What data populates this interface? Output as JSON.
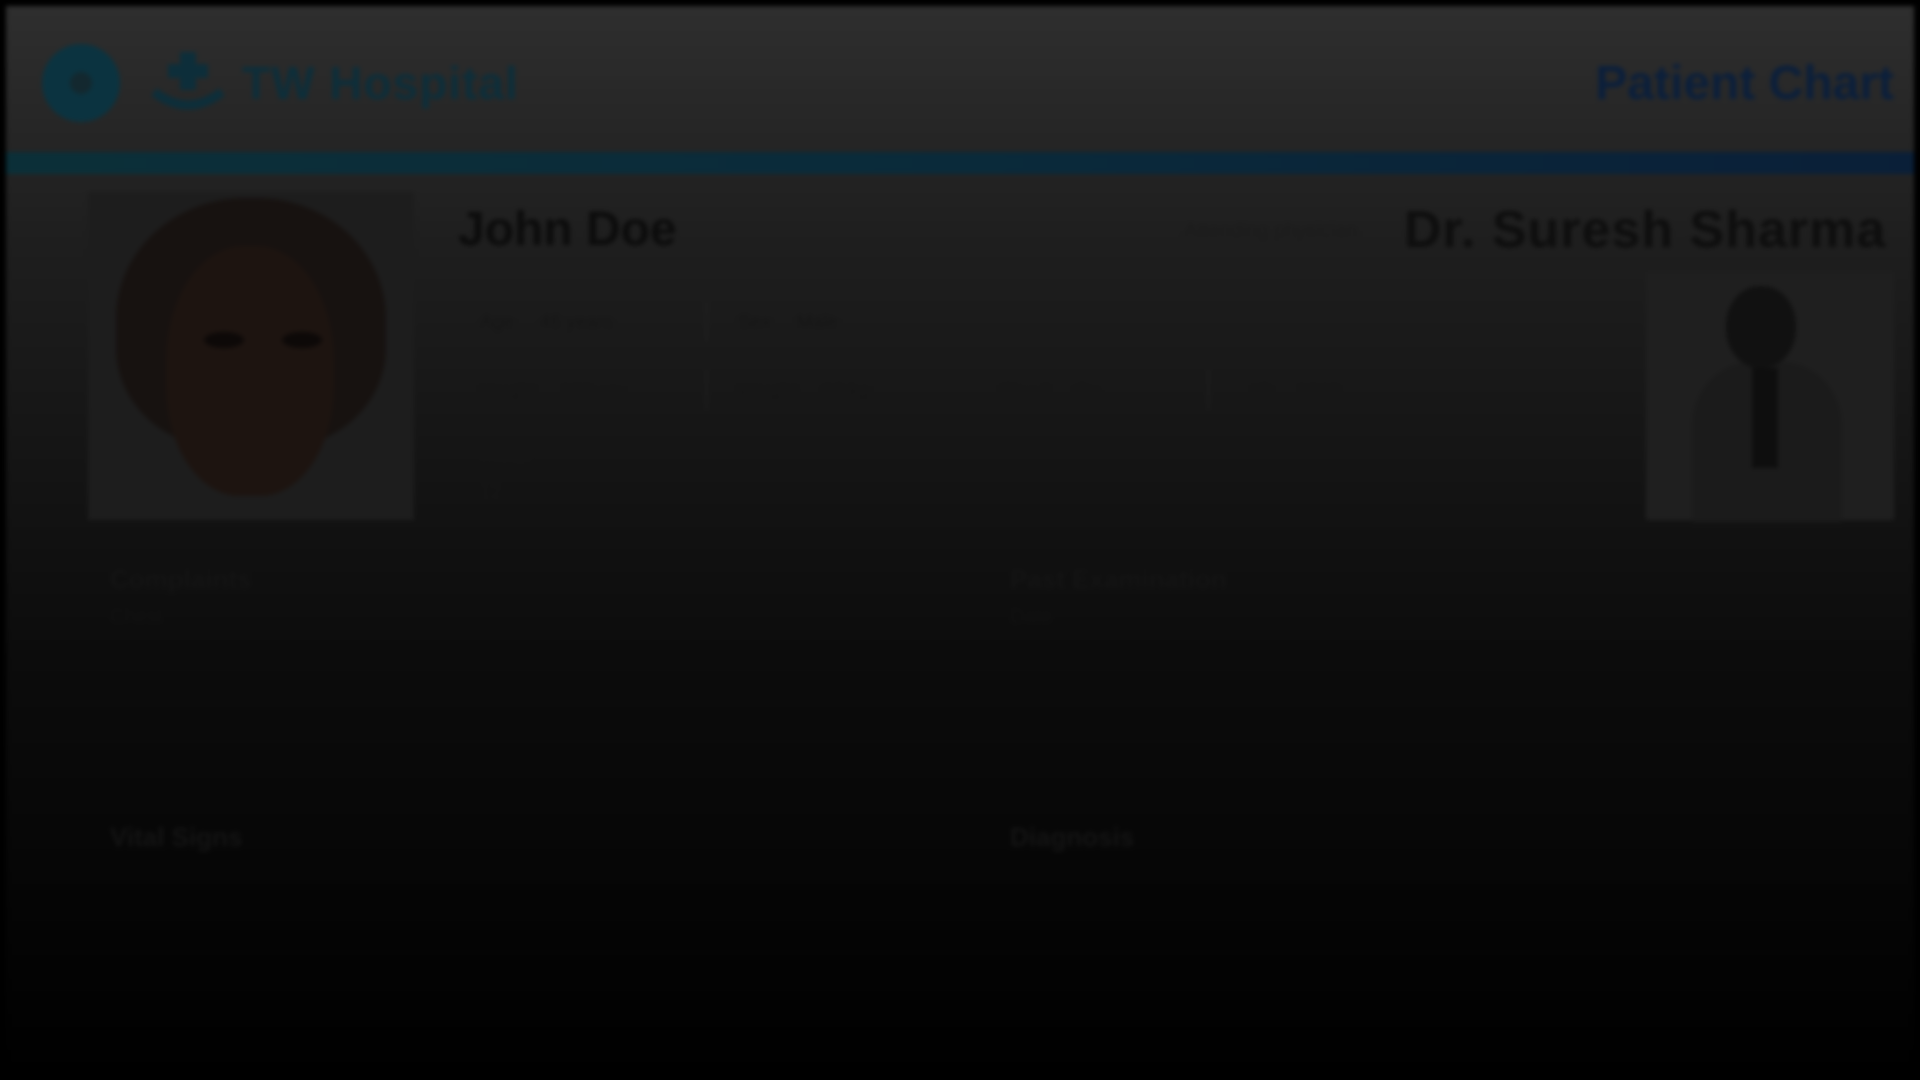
{
  "header": {
    "logo_text": "TW Hospital",
    "page_title": "Patient Chart",
    "colors": {
      "accent": "#0b2f38",
      "brand": "#0d2e3a"
    }
  },
  "patient": {
    "name": "John Doe",
    "fields": [
      {
        "label": "Age",
        "value": "46 years"
      },
      {
        "label": "Sex",
        "value": "Male"
      },
      {
        "label": "Height",
        "value": "178 cm"
      },
      {
        "label": "Weight",
        "value": "82 kg"
      },
      {
        "label": "Blood",
        "value": "O+"
      },
      {
        "label": "ID",
        "value": "1042"
      },
      {
        "label": "Room",
        "value": "12"
      }
    ],
    "extra_values": [
      "",
      "",
      ""
    ]
  },
  "doctor": {
    "label": "Attending physician",
    "name": "Dr. Suresh Sharma"
  },
  "sections": {
    "left_1": {
      "title": "Complaints",
      "sub": "Chest",
      "line": [
        "",
        "",
        ""
      ],
      "link": ""
    },
    "right_1": {
      "title": "Past Examination",
      "sub": "Date",
      "line": "",
      "right": "",
      "link": ""
    },
    "left_2": {
      "title": "Vital Signs",
      "line": "",
      "right": ""
    },
    "right_2": {
      "title": "Diagnosis",
      "line": "",
      "right": ""
    }
  },
  "icons": [
    "back-icon",
    "hospital-logo-icon"
  ]
}
